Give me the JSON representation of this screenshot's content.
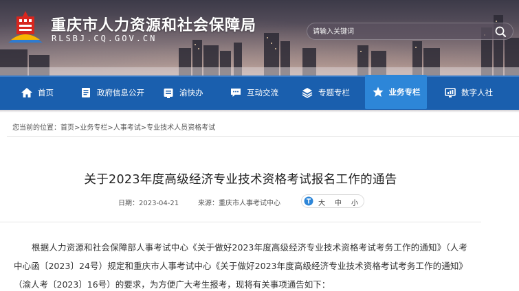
{
  "header": {
    "site_title": "重庆市人力资源和社会保障局",
    "site_domain": "RLSBJ.CQ.GOV.CN",
    "search": {
      "placeholder": "请输入关键词"
    }
  },
  "nav": {
    "items": [
      {
        "label": "首页",
        "icon": "home-icon"
      },
      {
        "label": "政府信息公开",
        "icon": "document-icon"
      },
      {
        "label": "渝快办",
        "icon": "service-icon"
      },
      {
        "label": "互动交流",
        "icon": "chat-icon"
      },
      {
        "label": "专题专栏",
        "icon": "layers-icon"
      },
      {
        "label": "业务专栏",
        "icon": "star-icon",
        "active": true
      },
      {
        "label": "数字人社",
        "icon": "chart-icon"
      }
    ]
  },
  "breadcrumb": {
    "prefix": "您当前的位置：",
    "items": [
      "首页",
      "业务专栏",
      "人事考试",
      "专业技术人员资格考试"
    ],
    "separator": ">"
  },
  "article": {
    "title": "关于2023年度高级经济专业技术资格考试报名工作的通告",
    "date": "日期：2023-04-21",
    "source": "来源：重庆市人事考试中心",
    "font_size": {
      "large": "大",
      "medium": "中",
      "small": "小"
    },
    "paragraph": "根据人力资源和社会保障部人事考试中心《关于做好2023年度高级经济专业技术资格考试考务工作的通知》（人考中心函〔2023〕24号）规定和重庆市人事考试中心《关于做好2023年度高级经济专业技术资格考试考务工作的通知》（渝人考〔2023〕16号）的要求，为方便广大考生报考，现将有关事项通告如下："
  },
  "colors": {
    "nav_bg": "#1a5fae",
    "nav_active": "#2d86d8",
    "text": "#333333"
  }
}
